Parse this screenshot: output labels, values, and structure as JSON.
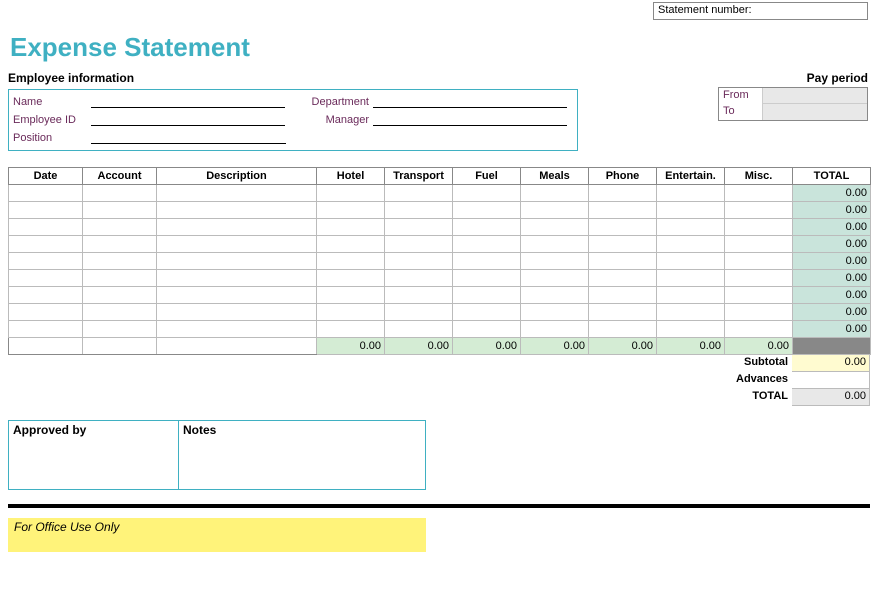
{
  "statement_number_label": "Statement number:",
  "title": "Expense Statement",
  "employee": {
    "header": "Employee information",
    "fields": {
      "name": "Name",
      "employee_id": "Employee ID",
      "position": "Position",
      "department": "Department",
      "manager": "Manager"
    }
  },
  "pay_period": {
    "header": "Pay period",
    "from_label": "From",
    "to_label": "To"
  },
  "columns": {
    "date": "Date",
    "account": "Account",
    "description": "Description",
    "hotel": "Hotel",
    "transport": "Transport",
    "fuel": "Fuel",
    "meals": "Meals",
    "phone": "Phone",
    "entertain": "Entertain.",
    "misc": "Misc.",
    "total": "TOTAL"
  },
  "rows": [
    {
      "total": "0.00"
    },
    {
      "total": "0.00"
    },
    {
      "total": "0.00"
    },
    {
      "total": "0.00"
    },
    {
      "total": "0.00"
    },
    {
      "total": "0.00"
    },
    {
      "total": "0.00"
    },
    {
      "total": "0.00"
    },
    {
      "total": "0.00"
    }
  ],
  "column_sums": {
    "hotel": "0.00",
    "transport": "0.00",
    "fuel": "0.00",
    "meals": "0.00",
    "phone": "0.00",
    "entertain": "0.00",
    "misc": "0.00"
  },
  "summary": {
    "subtotal_label": "Subtotal",
    "subtotal_value": "0.00",
    "advances_label": "Advances",
    "advances_value": "",
    "total_label": "TOTAL",
    "total_value": "0.00"
  },
  "approval": {
    "approved_by": "Approved by",
    "notes": "Notes"
  },
  "office_use": "For Office Use Only"
}
